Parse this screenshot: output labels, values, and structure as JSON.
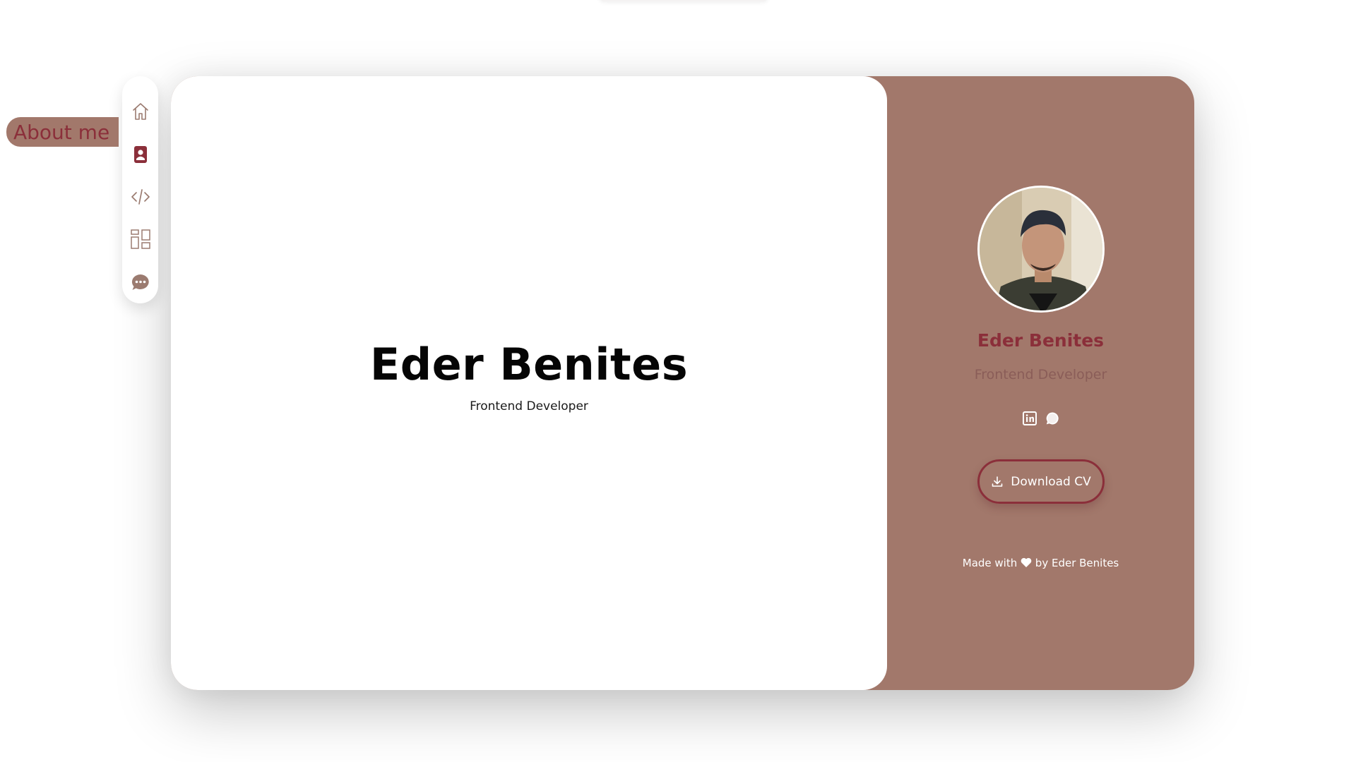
{
  "hero": {
    "title": "Eder Benites",
    "subtitle": "Frontend Developer"
  },
  "profile": {
    "name": "Eder Benites",
    "role": "Frontend Developer",
    "socials": [
      {
        "icon": "linkedin-icon"
      },
      {
        "icon": "whatsapp-icon"
      }
    ],
    "download_label": "Download CV",
    "footer_prefix": "Made with",
    "footer_suffix": "by Eder Benites"
  },
  "nav": {
    "items": [
      {
        "icon": "home-icon",
        "active": false
      },
      {
        "icon": "contact-card-icon",
        "active": true
      },
      {
        "icon": "code-icon",
        "active": false
      },
      {
        "icon": "grid-layout-icon",
        "active": false
      },
      {
        "icon": "chat-bubble-icon",
        "active": false
      }
    ],
    "tooltip": "About me"
  },
  "colors": {
    "accent": "#8b2f3a",
    "panel": "#a2786b",
    "background": "#ffffff"
  }
}
